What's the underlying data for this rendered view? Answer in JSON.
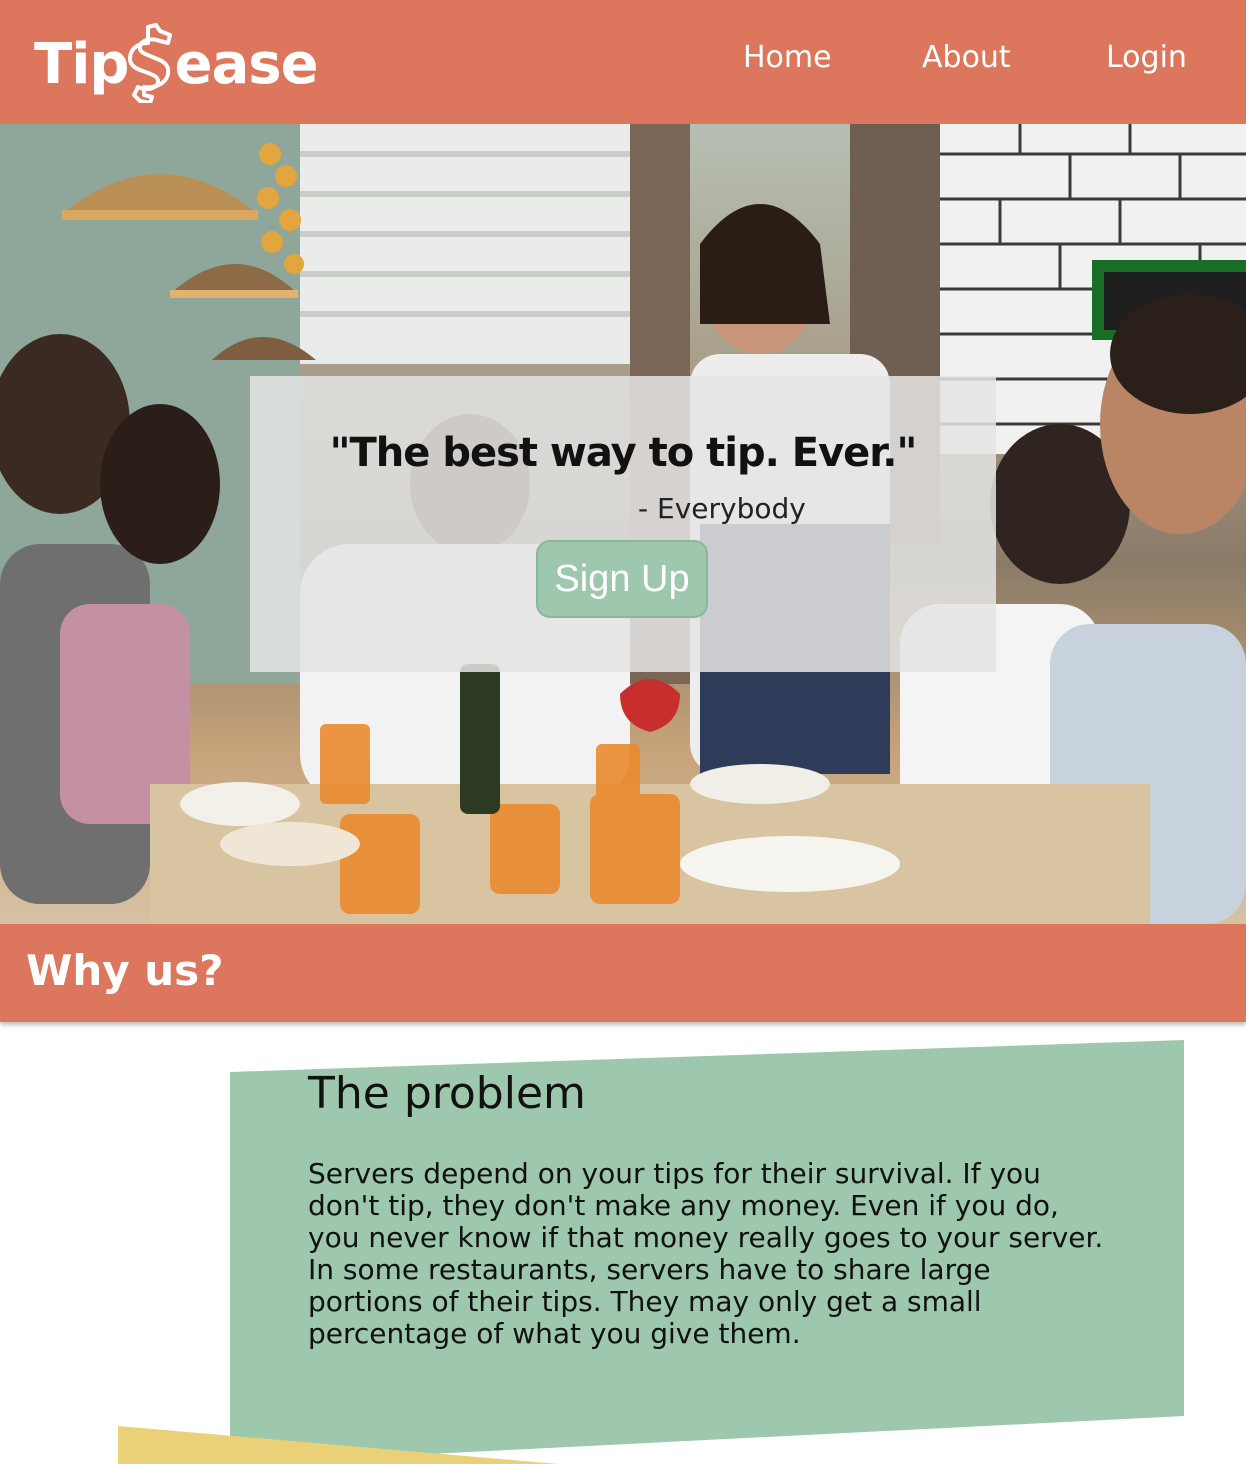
{
  "brand": {
    "name_left": "Tip",
    "name_right": "ease",
    "symbol": "$"
  },
  "nav": {
    "links": [
      {
        "label": "Home"
      },
      {
        "label": "About"
      },
      {
        "label": "Login"
      }
    ]
  },
  "hero": {
    "quote": "\"The best way to tip. Ever.\"",
    "attribution": "- Everybody",
    "cta_label": "Sign Up"
  },
  "section": {
    "title": "Why us?"
  },
  "problem": {
    "title": "The problem",
    "paragraphs": [
      "Servers depend on your tips for their survival. If you don't tip, they don't make any money. Even if you do, you never know if that money really goes to your server.",
      "In some restaurants, servers have to share large portions of their tips. They may only get a small percentage of what you give them."
    ]
  },
  "colors": {
    "brand_coral": "#dc775d",
    "accent_green": "#9dc8ad",
    "accent_yellow": "#ead077",
    "text_dark": "#111111"
  }
}
